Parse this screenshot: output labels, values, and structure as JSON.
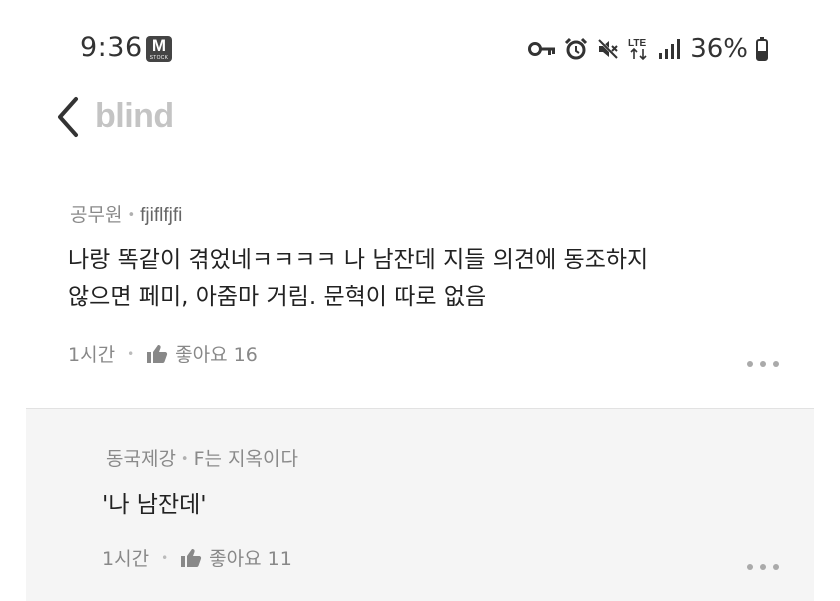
{
  "status_bar": {
    "time": "9:36",
    "app_badge": "M",
    "app_badge_sub": "STOCK",
    "battery": "36%",
    "icons": [
      "key-icon",
      "alarm-icon",
      "mute-icon",
      "lte-icon",
      "signal-icon",
      "battery-icon"
    ]
  },
  "header": {
    "back_icon": "chevron-left-icon",
    "logo": "blind"
  },
  "comment": {
    "company": "공무원",
    "nickname": "fjiflfjfi",
    "text_line1": "나랑 똑같이 겪었네ㅋㅋㅋㅋ 나 남잔데 지들 의견에 동조하지",
    "text_line2": "않으면 페미, 아줌마 거림. 문혁이 따로 없음",
    "time": "1시간",
    "like_label": "좋아요 16"
  },
  "reply": {
    "company": "동국제강",
    "nickname": "F는 지옥이다",
    "text": "'나 남잔데'",
    "time": "1시간",
    "like_label": "좋아요 11"
  },
  "colors": {
    "logo": "#c4c4c4",
    "reply_background": "#f5f5f5",
    "meta_text": "#8a8a8a"
  }
}
